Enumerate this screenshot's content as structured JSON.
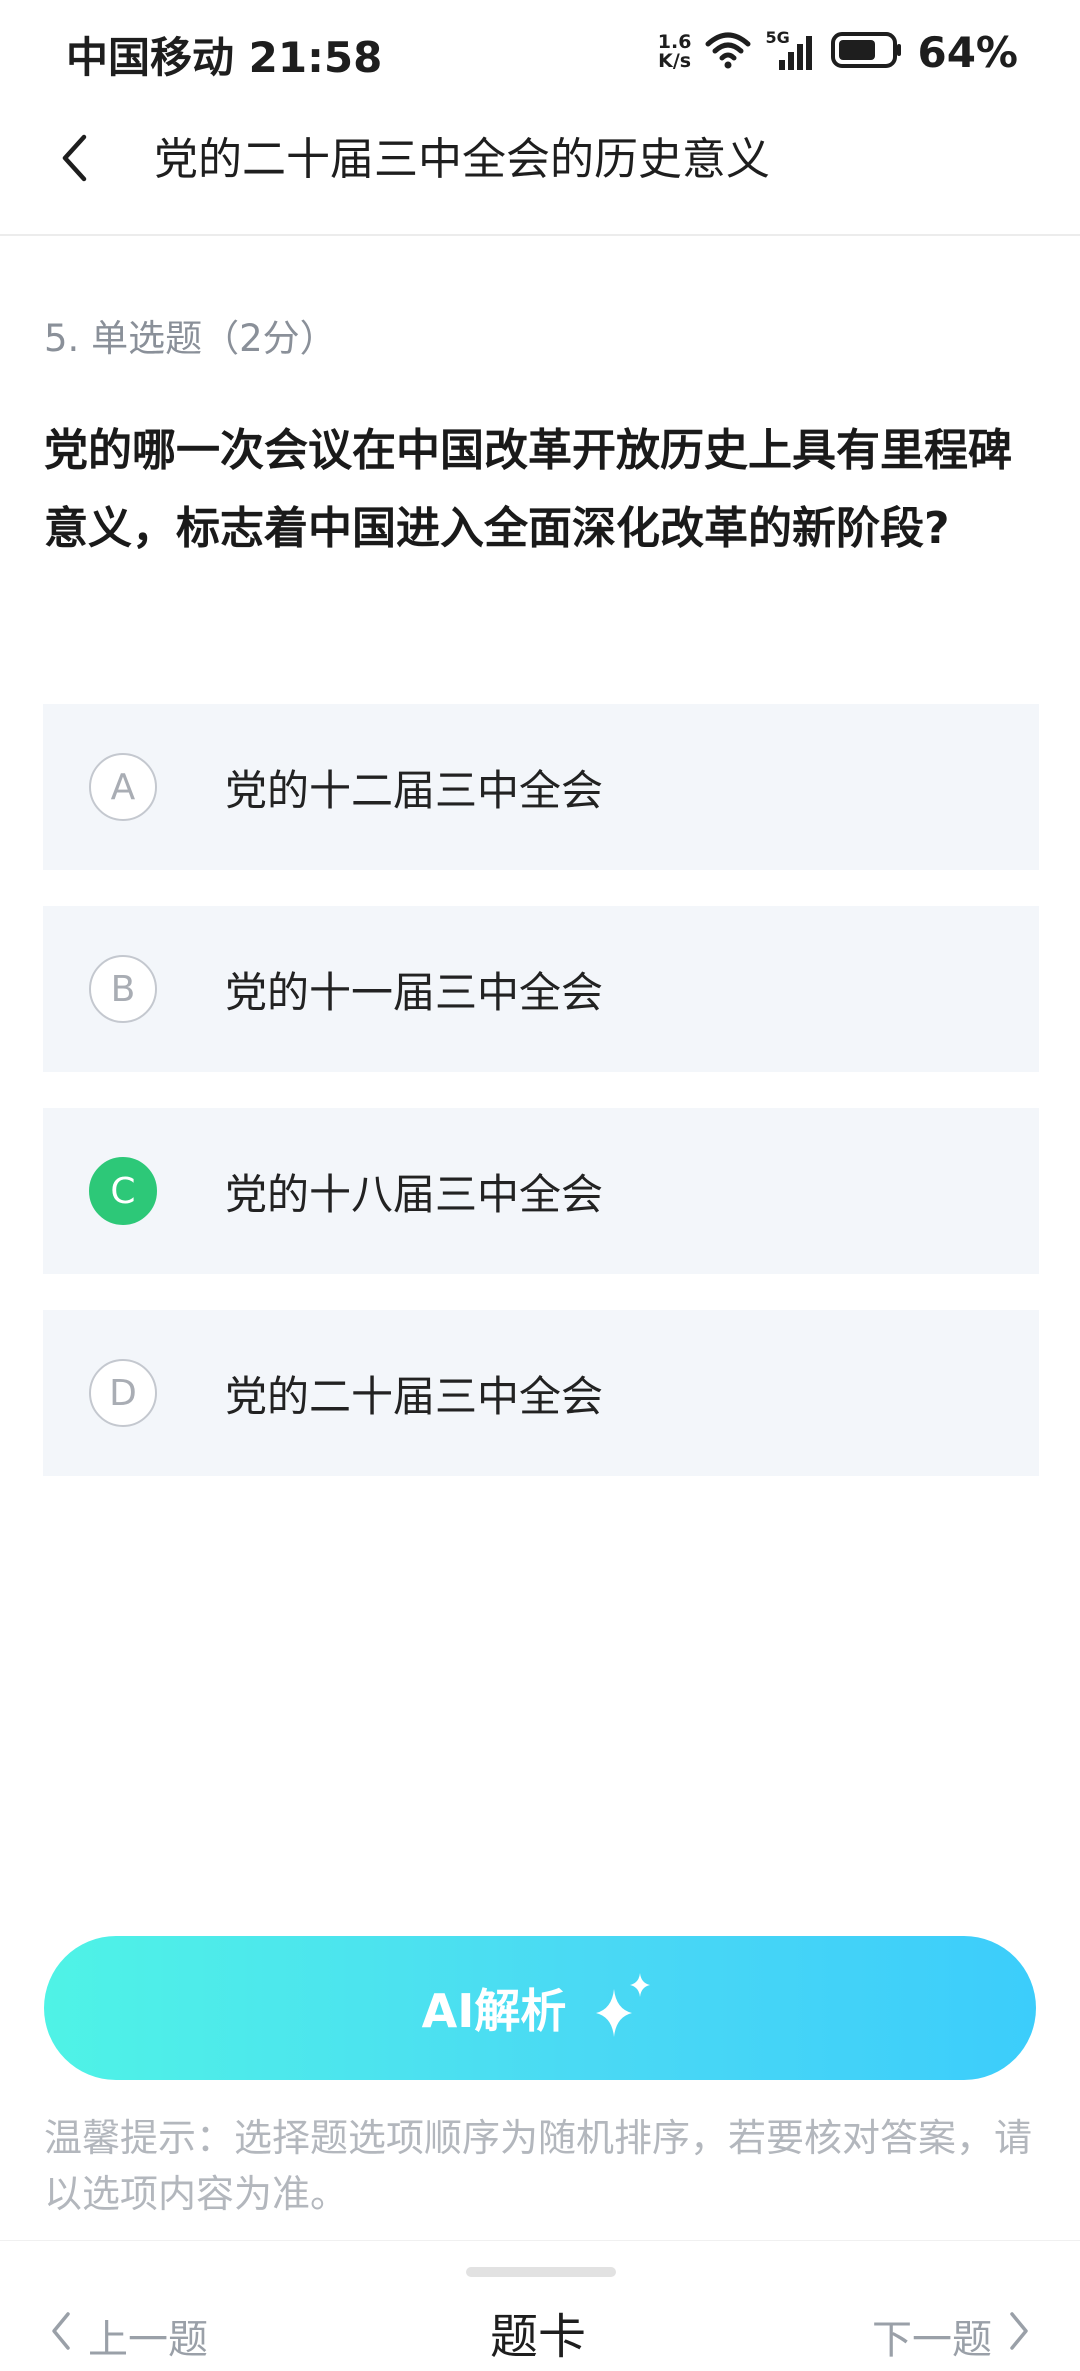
{
  "status_bar": {
    "carrier_time": "中国移动 21:58",
    "net_speed_value": "1.6",
    "net_speed_unit": "K/s",
    "signal_label": "5G",
    "battery": "64%"
  },
  "nav": {
    "title": "党的二十届三中全会的历史意义"
  },
  "question": {
    "meta": "5. 单选题（2分）",
    "text": "党的哪一次会议在中国改革开放历史上具有里程碑意义，标志着中国进入全面深化改革的新阶段?"
  },
  "options": [
    {
      "letter": "A",
      "text": "党的十二届三中全会",
      "selected": false
    },
    {
      "letter": "B",
      "text": "党的十一届三中全会",
      "selected": false
    },
    {
      "letter": "C",
      "text": "党的十八届三中全会",
      "selected": true
    },
    {
      "letter": "D",
      "text": "党的二十届三中全会",
      "selected": false
    }
  ],
  "ai_button": {
    "label": "AI解析",
    "icon": "sparkle-icon"
  },
  "tip": "温馨提示：选择题选项顺序为随机排序，若要核对答案，请以选项内容为准。",
  "bottom_nav": {
    "prev": "上一题",
    "card": "题卡",
    "next": "下一题"
  },
  "colors": {
    "selected": "#2dc878",
    "option_bg": "#f3f6fa",
    "ai_gradient_start": "#4ff3e6",
    "ai_gradient_end": "#3ccdfb"
  }
}
